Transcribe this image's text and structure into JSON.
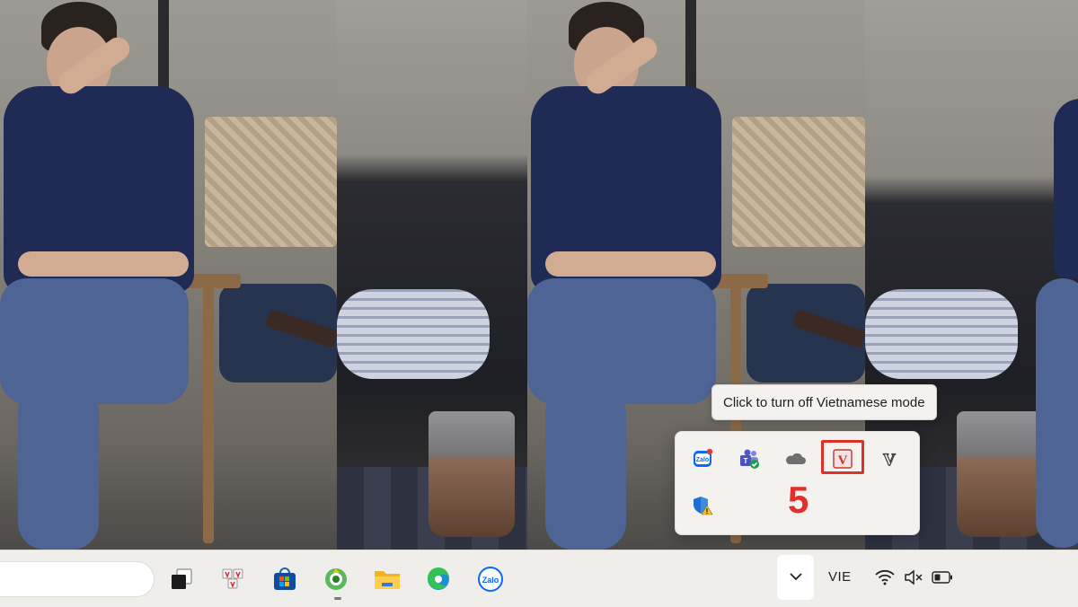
{
  "tooltip": {
    "text": "Click to turn off Vietnamese mode"
  },
  "annotation": {
    "step_number": "5"
  },
  "taskbar": {
    "language_indicator": "VIE",
    "pinned_apps": [
      {
        "name": "task-view",
        "icon": "task-view-icon"
      },
      {
        "name": "unikey-app",
        "icon": "keyboard-app-icon"
      },
      {
        "name": "microsoft-store",
        "icon": "store-icon"
      },
      {
        "name": "coc-coc-browser",
        "icon": "coccoc-icon"
      },
      {
        "name": "file-explorer",
        "icon": "folder-icon"
      },
      {
        "name": "microsoft-edge",
        "icon": "edge-icon"
      },
      {
        "name": "zalo",
        "icon": "zalo-icon",
        "label": "Zalo"
      }
    ],
    "system_icons": [
      "chevron-up-icon",
      "wifi-icon",
      "speaker-muted-icon",
      "battery-icon"
    ]
  },
  "tray_overflow": {
    "items": [
      {
        "name": "zalo",
        "icon": "zalo-notify-icon",
        "label": "Zalo"
      },
      {
        "name": "teams",
        "icon": "teams-icon"
      },
      {
        "name": "onedrive",
        "icon": "cloud-icon"
      },
      {
        "name": "vietkey-on",
        "icon": "v-red-icon",
        "label": "V"
      },
      {
        "name": "evkey",
        "icon": "v-outline-icon",
        "label": "V"
      },
      {
        "name": "windows-security",
        "icon": "shield-warning-icon"
      }
    ]
  },
  "colors": {
    "annotation_red": "#e0302a",
    "taskbar_bg": "#f0eeeb"
  }
}
